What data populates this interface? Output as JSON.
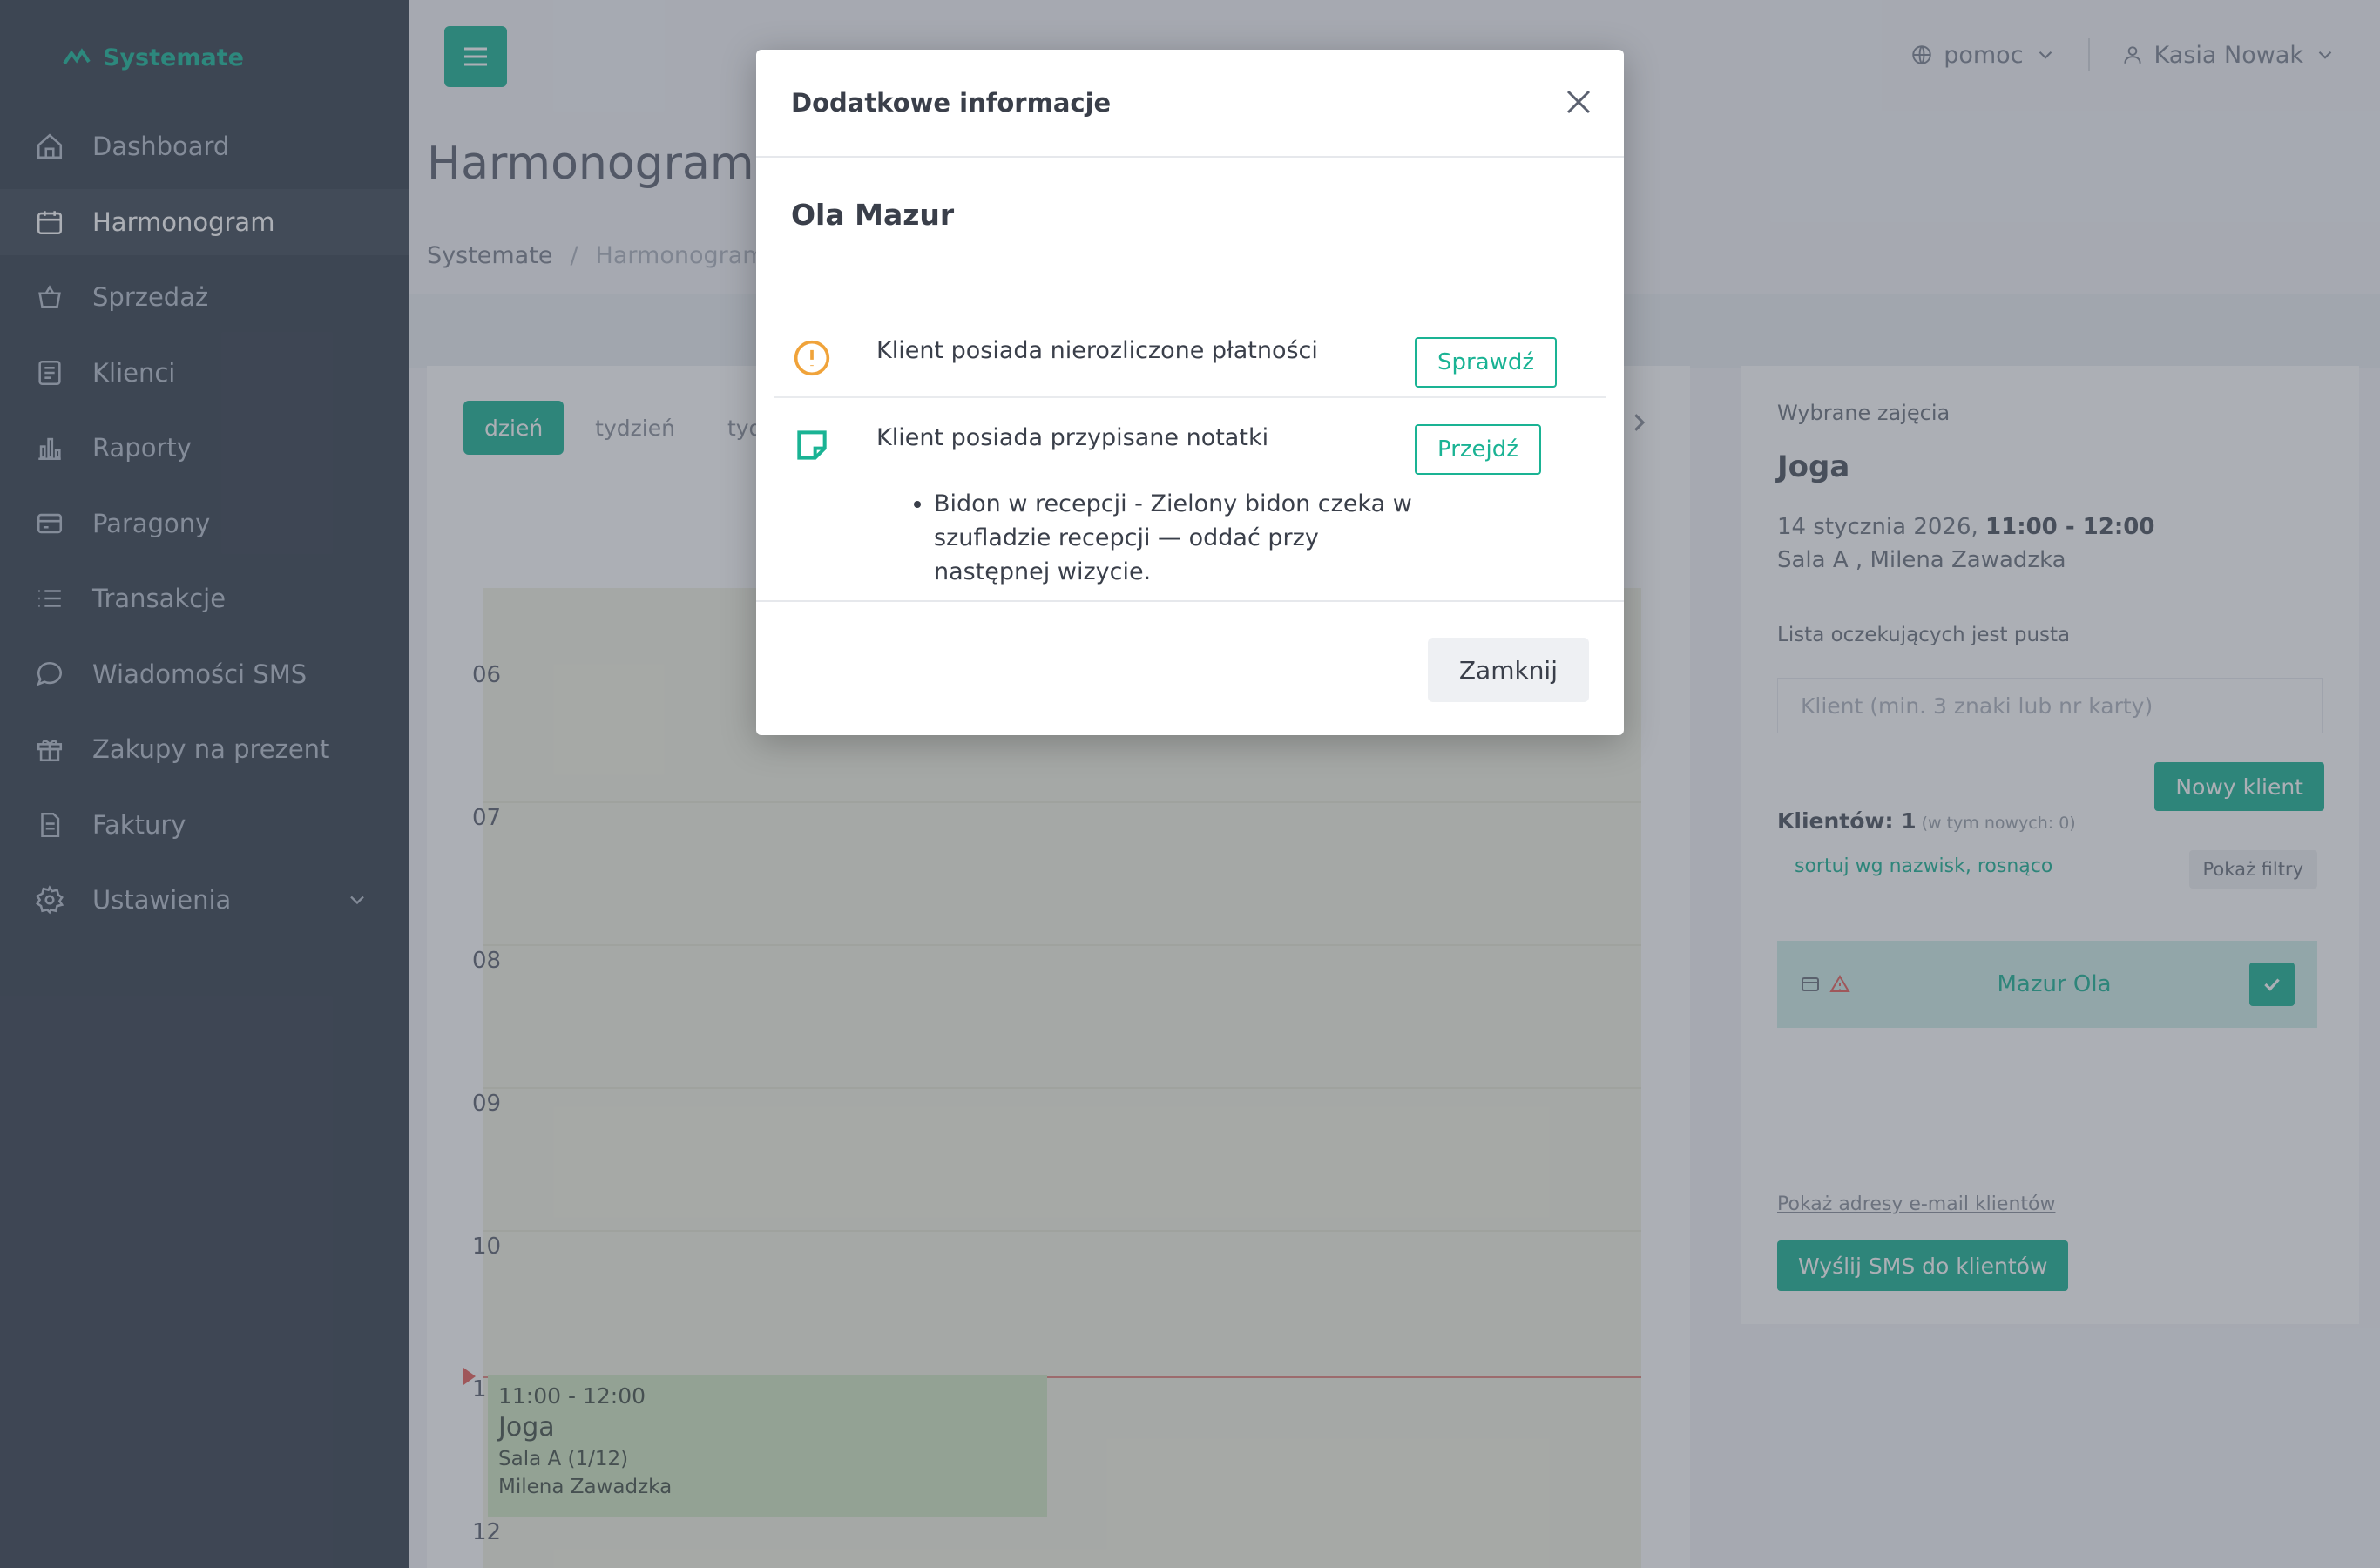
{
  "sidebar": {
    "brand": "Systemate",
    "items": [
      {
        "label": "Dashboard",
        "icon": "home-icon"
      },
      {
        "label": "Harmonogram",
        "icon": "calendar-icon"
      },
      {
        "label": "Sprzedaż",
        "icon": "basket-icon"
      },
      {
        "label": "Klienci",
        "icon": "clients-icon"
      },
      {
        "label": "Raporty",
        "icon": "chart-icon"
      },
      {
        "label": "Paragony",
        "icon": "receipt-icon"
      },
      {
        "label": "Transakcje",
        "icon": "list-icon"
      },
      {
        "label": "Wiadomości SMS",
        "icon": "message-icon"
      },
      {
        "label": "Zakupy na prezent",
        "icon": "gift-icon"
      },
      {
        "label": "Faktury",
        "icon": "invoice-icon"
      },
      {
        "label": "Ustawienia",
        "icon": "settings-icon"
      }
    ]
  },
  "header": {
    "help": "pomoc",
    "user": "Kasia Nowak",
    "page_title": "Harmonogram",
    "breadcrumb": [
      "Systemate",
      "/",
      "Harmonogram"
    ]
  },
  "calendar": {
    "views": [
      "dzień",
      "tydzień",
      "tydz"
    ],
    "hours": [
      "06",
      "07",
      "08",
      "09",
      "10",
      "11",
      "12"
    ],
    "event": {
      "time": "11:00 - 12:00",
      "name": "Joga",
      "room": "Sala A (1/12)",
      "trainer": "Milena Zawadzka"
    }
  },
  "right_panel": {
    "caption": "Wybrane zajęcia",
    "class_name": "Joga",
    "date": "14 stycznia 2026,",
    "time": "11:00 - 12:00",
    "room": "Sala A , Milena Zawadzka",
    "waiting": "Lista oczekujących jest pusta",
    "search_placeholder": "Klient (min. 3 znaki lub nr karty)",
    "new_client": "Nowy klient",
    "count_label": "Klientów: 1",
    "count_sub": "(w tym nowych: 0)",
    "sort": "sortuj wg nazwisk, rosnąco",
    "filters": "Pokaż filtry",
    "client": "Mazur Ola",
    "emails": "Pokaż adresy e-mail klientów",
    "sms": "Wyślij SMS do klientów"
  },
  "modal": {
    "title": "Dodatkowe informacje",
    "client": "Ola Mazur",
    "row1_text": "Klient posiada nierozliczone płatności",
    "row1_button": "Sprawdź",
    "row2_text": "Klient posiada przypisane notatki",
    "row2_button": "Przejdź",
    "notes": [
      "Bidon w recepcji - Zielony bidon czeka w szufladzie recepcji — oddać przy następnej wizycie."
    ],
    "close_button": "Zamknij"
  },
  "colors": {
    "accent": "#1ab394",
    "warning": "#f0a33a",
    "sidebar": "#36404e"
  }
}
